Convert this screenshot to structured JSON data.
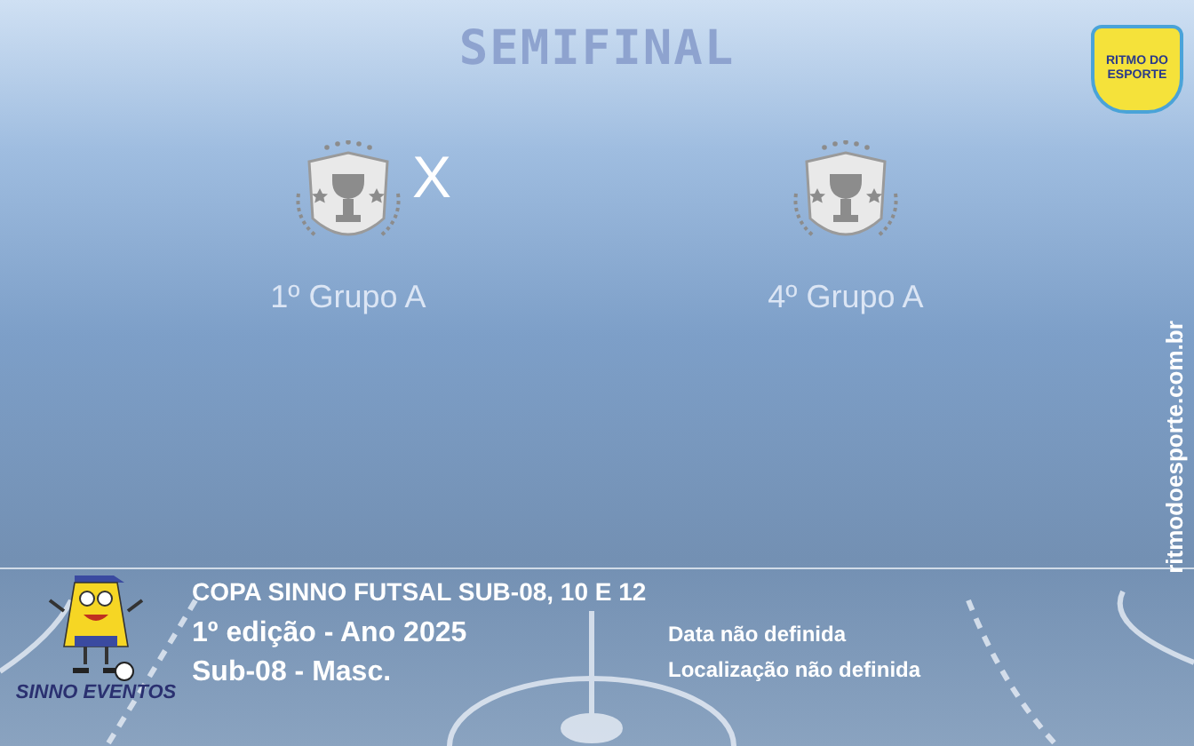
{
  "phase": "SEMIFINAL",
  "brand_logo": {
    "line_1": "RITMO DO",
    "line_2": "ESPORTE"
  },
  "match": {
    "home": {
      "name": "1º Grupo A"
    },
    "separator": "X",
    "away": {
      "name": "4º Grupo A"
    }
  },
  "website": "ritmodoesporte.com.br",
  "organizer_logo": {
    "text": "SINNO EVENTOS"
  },
  "tournament": {
    "title": "COPA SINNO FUTSAL SUB-08, 10 E 12",
    "edition": "1º edição - Ano 2025",
    "category": "Sub-08 - Masc."
  },
  "details": {
    "date": "Data não definida",
    "location": "Localização não definida"
  }
}
